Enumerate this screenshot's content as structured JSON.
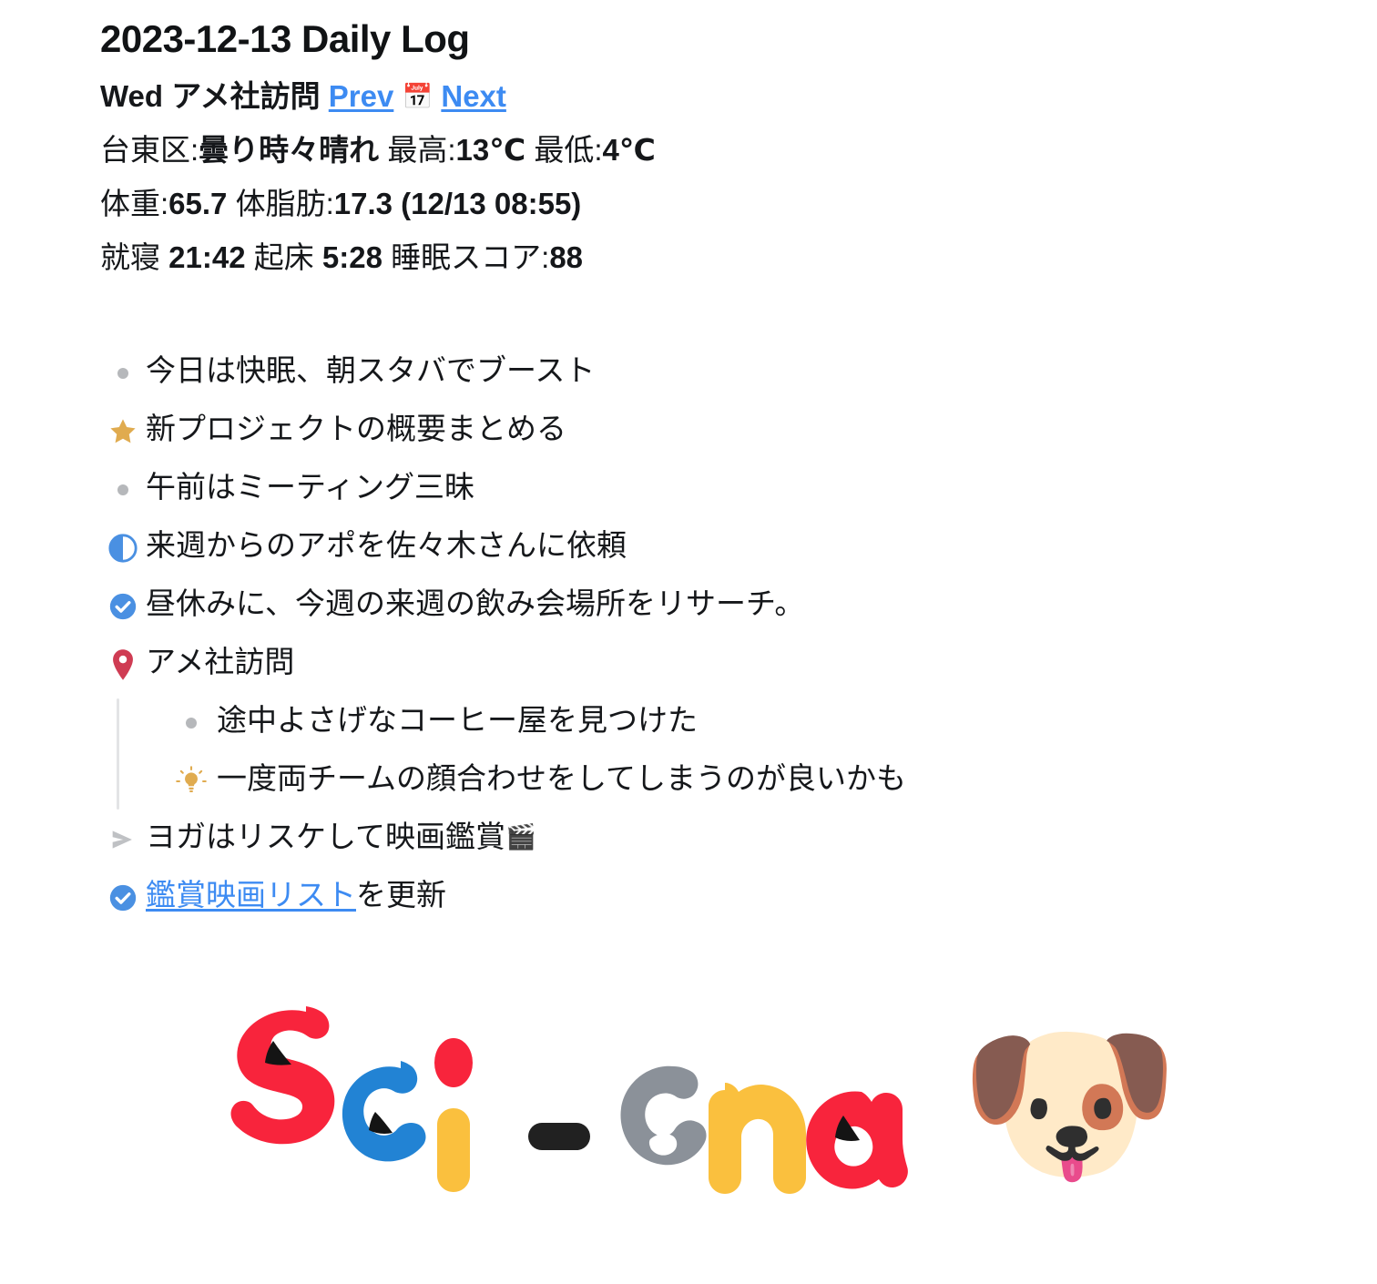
{
  "header": {
    "title": "2023-12-13 Daily Log",
    "line2": {
      "weekday": "Wed",
      "event": "アメ社訪問",
      "prev_label": "Prev",
      "calendar_icon": "calendar-emoji",
      "calendar_glyph": "📅",
      "next_label": "Next"
    },
    "weather": {
      "area_label": "台東区:",
      "condition": "曇り時々晴れ",
      "high_label": "最高:",
      "high_value": "13℃",
      "low_label": "最低:",
      "low_value": "4℃",
      "full": "台東区:曇り時々晴れ 最高:13℃ 最低:4℃"
    },
    "body_stats": {
      "weight_label": "体重:",
      "weight_value": "65.7",
      "fat_label": "体脂肪:",
      "fat_value": "17.3",
      "measured_at": "(12/13 08:55)",
      "full": "体重:65.7 体脂肪:17.3 (12/13 08:55)"
    },
    "sleep": {
      "bed_label": "就寝",
      "bed_time": "21:42",
      "wake_label": "起床",
      "wake_time": "5:28",
      "score_label": "睡眠スコア:",
      "score_value": "88",
      "full": "就寝 21:42 起床 5:28 睡眠スコア:88"
    }
  },
  "list": {
    "items": [
      {
        "marker": "bullet",
        "text": "今日は快眠、朝スタバでブースト"
      },
      {
        "marker": "star",
        "text": "新プロジェクトの概要まとめる"
      },
      {
        "marker": "bullet",
        "text": "午前はミーティング三昧"
      },
      {
        "marker": "half-circle",
        "text": "来週からのアポを佐々木さんに依頼"
      },
      {
        "marker": "check-circle",
        "text": "昼休みに、今週の来週の飲み会場所をリサーチ。"
      },
      {
        "marker": "map-pin",
        "text": "アメ社訪問"
      }
    ],
    "nested": [
      {
        "marker": "bullet",
        "text": "途中よさげなコーヒー屋を見つけた"
      },
      {
        "marker": "lightbulb",
        "text": "一度両チームの顔合わせをしてしまうのが良いかも"
      }
    ],
    "tail": [
      {
        "marker": "arrow",
        "text": "ヨガはリスケして映画鑑賞",
        "trailing_emoji": "🎬",
        "trailing_emoji_name": "clapper-board-emoji"
      },
      {
        "marker": "check-circle",
        "link_text": "鑑賞映画リスト",
        "text_after": "を更新"
      }
    ]
  },
  "logo": {
    "text": "Sci - ena",
    "letters": [
      {
        "char": "S",
        "color": "#f8243c"
      },
      {
        "char": "c",
        "color": "#2283d4"
      },
      {
        "char": "i",
        "color": "#fac03e",
        "dot_color": "#f8243c"
      },
      {
        "char": "-",
        "color": "#212121"
      },
      {
        "char": "e",
        "color": "#8b9199"
      },
      {
        "char": "n",
        "color": "#fac03e"
      },
      {
        "char": "a",
        "color": "#f8243c"
      }
    ],
    "mascot_emoji": "🐶",
    "mascot_name": "dog-face-emoji"
  },
  "colors": {
    "link": "#3d8bf2",
    "accent_gold": "#e0ab4f",
    "accent_blue": "#4a90e2",
    "accent_red": "#cf3c53",
    "bullet_gray": "#b6b8bb",
    "arrow_gray": "#bfc1c4",
    "guide_line": "#e3e4e6"
  }
}
